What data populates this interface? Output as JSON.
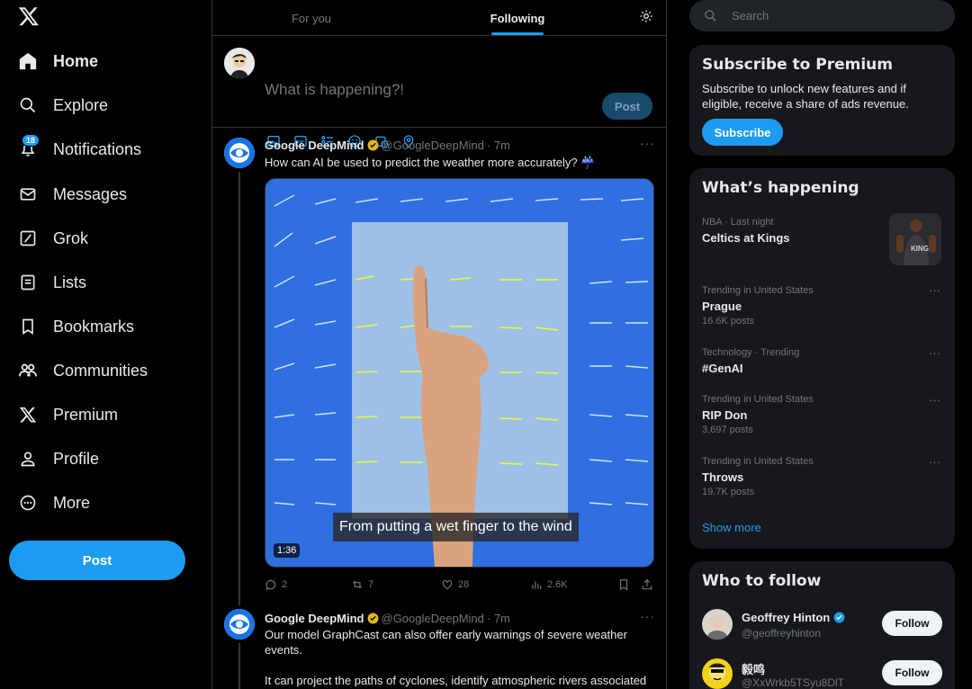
{
  "colors": {
    "accent": "#1d9bf0",
    "background": "#000000",
    "text": "#e7e9ea",
    "muted": "#71767b",
    "card": "#16181c"
  },
  "nav": {
    "items": [
      {
        "label": "Home",
        "icon": "home-icon"
      },
      {
        "label": "Explore",
        "icon": "search-icon"
      },
      {
        "label": "Notifications",
        "icon": "bell-icon",
        "badge": "18"
      },
      {
        "label": "Messages",
        "icon": "envelope-icon"
      },
      {
        "label": "Grok",
        "icon": "grok-icon"
      },
      {
        "label": "Lists",
        "icon": "list-icon"
      },
      {
        "label": "Bookmarks",
        "icon": "bookmark-icon"
      },
      {
        "label": "Communities",
        "icon": "communities-icon"
      },
      {
        "label": "Premium",
        "icon": "x-logo-icon"
      },
      {
        "label": "Profile",
        "icon": "person-icon"
      },
      {
        "label": "More",
        "icon": "more-circle-icon"
      }
    ],
    "post_label": "Post"
  },
  "timeline": {
    "tabs": {
      "for_you": "For you",
      "following": "Following"
    },
    "composer": {
      "placeholder": "What is happening?!",
      "post_label": "Post"
    },
    "tweets": [
      {
        "name": "Google DeepMind",
        "handle": "@GoogleDeepMind",
        "time": "· 7m",
        "text": "How can AI be used to predict the weather more accurately? ☔",
        "video_caption": "From putting a wet finger to the wind",
        "video_duration": "1:36",
        "replies": "2",
        "reposts": "7",
        "likes": "28",
        "views": "2.6K"
      },
      {
        "name": "Google DeepMind",
        "handle": "@GoogleDeepMind",
        "time": "· 7m",
        "text1": "Our model GraphCast can also offer early warnings of severe weather events.",
        "text2": "It can project the paths of cyclones, identify atmospheric rivers associated"
      }
    ]
  },
  "sidebar": {
    "search_placeholder": "Search",
    "premium": {
      "title": "Subscribe to Premium",
      "description": "Subscribe to unlock new features and if eligible, receive a share of ads revenue.",
      "button": "Subscribe"
    },
    "happening": {
      "title": "What’s happening",
      "trends": [
        {
          "meta": "NBA · Last night",
          "name": "Celtics at Kings",
          "count": ""
        },
        {
          "meta": "Trending in United States",
          "name": "Prague",
          "count": "16.6K posts"
        },
        {
          "meta": "Technology · Trending",
          "name": "#GenAI",
          "count": ""
        },
        {
          "meta": "Trending in United States",
          "name": "RIP Don",
          "count": "3,697 posts"
        },
        {
          "meta": "Trending in United States",
          "name": "Throws",
          "count": "19.7K posts"
        }
      ],
      "show_more": "Show more"
    },
    "who_to_follow": {
      "title": "Who to follow",
      "users": [
        {
          "name": "Geoffrey Hinton",
          "handle": "@geoffreyhinton",
          "verified": true,
          "button": "Follow"
        },
        {
          "name": "毅鸣",
          "handle": "@XxWrkb5TSyu8DlT",
          "verified": false,
          "button": "Follow"
        }
      ]
    }
  }
}
